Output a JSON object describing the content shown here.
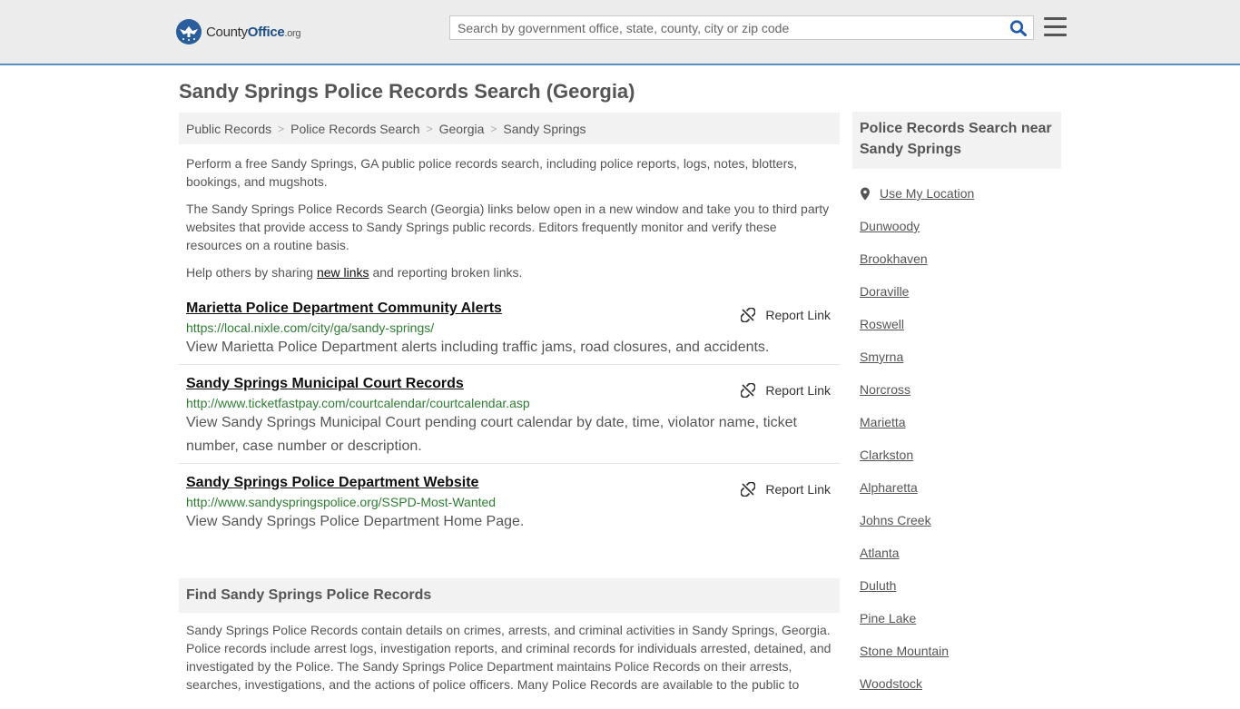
{
  "header": {
    "logo": {
      "part1": "County",
      "part2": "Office",
      "part3": ".org"
    },
    "search_placeholder": "Search by government office, state, county, city or zip code",
    "search_value": ""
  },
  "page_title": "Sandy Springs Police Records Search (Georgia)",
  "breadcrumb": [
    "Public Records",
    "Police Records Search",
    "Georgia",
    "Sandy Springs"
  ],
  "intro": {
    "p1": "Perform a free Sandy Springs, GA public police records search, including police reports, logs, notes, blotters, bookings, and mugshots.",
    "p2": "The Sandy Springs Police Records Search (Georgia) links below open in a new window and take you to third party websites that provide access to Sandy Springs public records. Editors frequently monitor and verify these resources on a routine basis.",
    "p3_before": "Help others by sharing ",
    "p3_link": "new links",
    "p3_after": " and reporting broken links."
  },
  "report_label": "Report Link",
  "links": [
    {
      "title": "Marietta Police Department Community Alerts",
      "url": "https://local.nixle.com/city/ga/sandy-springs/",
      "desc": "View Marietta Police Department alerts including traffic jams, road closures, and accidents."
    },
    {
      "title": "Sandy Springs Municipal Court Records",
      "url": "http://www.ticketfastpay.com/courtcalendar/courtcalendar.asp",
      "desc": "View Sandy Springs Municipal Court pending court calendar by date, time, violator name, ticket number, case number or description."
    },
    {
      "title": "Sandy Springs Police Department Website",
      "url": "http://www.sandyspringspolice.org/SSPD-Most-Wanted",
      "desc": "View Sandy Springs Police Department Home Page."
    }
  ],
  "find_section": {
    "heading": "Find Sandy Springs Police Records",
    "body": "Sandy Springs Police Records contain details on crimes, arrests, and criminal activities in Sandy Springs, Georgia. Police records include arrest logs, investigation reports, and criminal records for individuals arrested, detained, and investigated by the Police. The Sandy Springs Police Department maintains Police Records on their arrests, searches, investigations, and the actions of police officers. Many Police Records are available to the public to"
  },
  "sidebar": {
    "heading": "Police Records Search near Sandy Springs",
    "use_location": "Use My Location",
    "nearby": [
      "Dunwoody",
      "Brookhaven",
      "Doraville",
      "Roswell",
      "Smyrna",
      "Norcross",
      "Marietta",
      "Clarkston",
      "Alpharetta",
      "Johns Creek",
      "Atlanta",
      "Duluth",
      "Pine Lake",
      "Stone Mountain",
      "Woodstock"
    ]
  },
  "colors": {
    "accent_border": "#5b8ec2",
    "logo_blue": "#1c4f8a",
    "url_green": "#2e7d32",
    "search_icon_blue": "#1f5aa6"
  },
  "icons": {
    "logo": "eagle-seal-icon",
    "search": "magnifier-icon",
    "menu": "hamburger-icon",
    "report": "broken-link-icon",
    "location": "map-pin-icon"
  }
}
